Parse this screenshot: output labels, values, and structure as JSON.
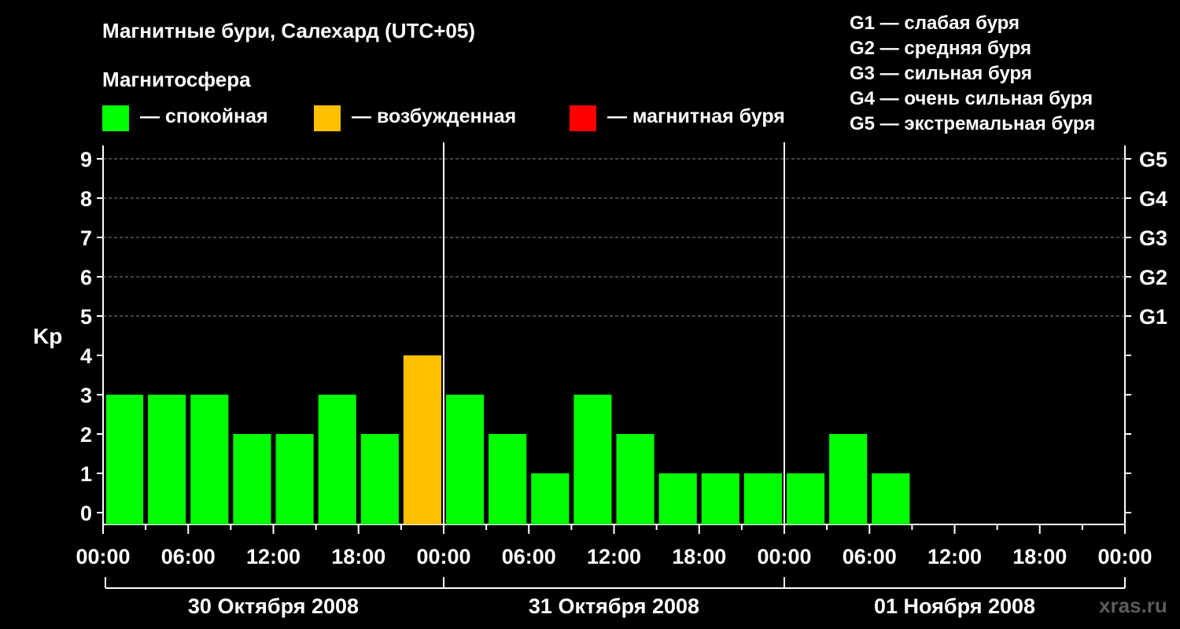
{
  "title": "Магнитные бури, Салехард (UTC+05)",
  "subtitle": "Магнитосфера",
  "legend": [
    {
      "label": "— спокойная",
      "color": "#00ff00"
    },
    {
      "label": "— возбужденная",
      "color": "#ffc000"
    },
    {
      "label": "— магнитная буря",
      "color": "#ff0000"
    }
  ],
  "g_legend": [
    "G1 — слабая буря",
    "G2 — средняя буря",
    "G3 — сильная буря",
    "G4 — очень сильная буря",
    "G5 — экстремальная буря"
  ],
  "watermark": "xras.ru",
  "chart_data": {
    "type": "bar",
    "ylabel": "Kp",
    "ylim": [
      0,
      9
    ],
    "y_ticks": [
      0,
      1,
      2,
      3,
      4,
      5,
      6,
      7,
      8,
      9
    ],
    "right_ticks": [
      {
        "value": 5,
        "label": "G1"
      },
      {
        "value": 6,
        "label": "G2"
      },
      {
        "value": 7,
        "label": "G3"
      },
      {
        "value": 8,
        "label": "G4"
      },
      {
        "value": 9,
        "label": "G5"
      }
    ],
    "grid_y_dashed": [
      5,
      6,
      7,
      8,
      9
    ],
    "x_tick_labels": [
      "00:00",
      "06:00",
      "12:00",
      "18:00",
      "00:00",
      "06:00",
      "12:00",
      "18:00",
      "00:00",
      "06:00",
      "12:00",
      "18:00",
      "00:00"
    ],
    "days": [
      "30 Октября 2008",
      "31 Октября 2008",
      "01 Ноября 2008"
    ],
    "interval_hours": 3,
    "values": [
      3,
      3,
      3,
      2,
      2,
      3,
      2,
      4,
      3,
      2,
      1,
      3,
      2,
      1,
      1,
      1,
      1,
      2,
      1
    ],
    "thresholds": {
      "quiet_below": 4,
      "storm_from": 5
    },
    "colors": {
      "quiet": "#00ff00",
      "active": "#ffc000",
      "storm": "#ff0000"
    }
  }
}
